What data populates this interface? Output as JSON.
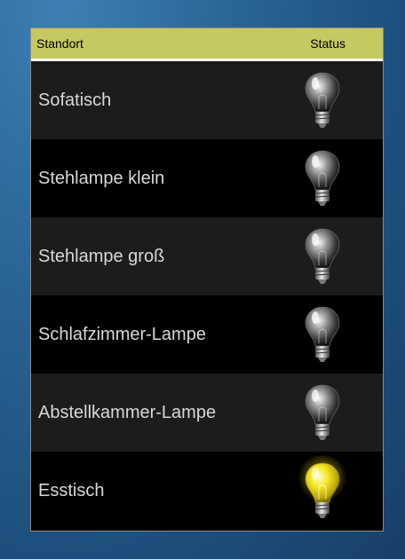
{
  "table": {
    "header": {
      "location": "Standort",
      "status": "Status"
    },
    "rows": [
      {
        "location": "Sofatisch",
        "status": "off"
      },
      {
        "location": "Stehlampe klein",
        "status": "off"
      },
      {
        "location": "Stehlampe groß",
        "status": "off"
      },
      {
        "location": "Schlafzimmer-Lampe",
        "status": "off"
      },
      {
        "location": "Abstellkammer-Lampe",
        "status": "off"
      },
      {
        "location": "Esstisch",
        "status": "on"
      }
    ]
  },
  "colors": {
    "header_bg": "#c6c862",
    "bulb_on": "#f2e21a",
    "bulb_off": "#bfbfbf"
  }
}
